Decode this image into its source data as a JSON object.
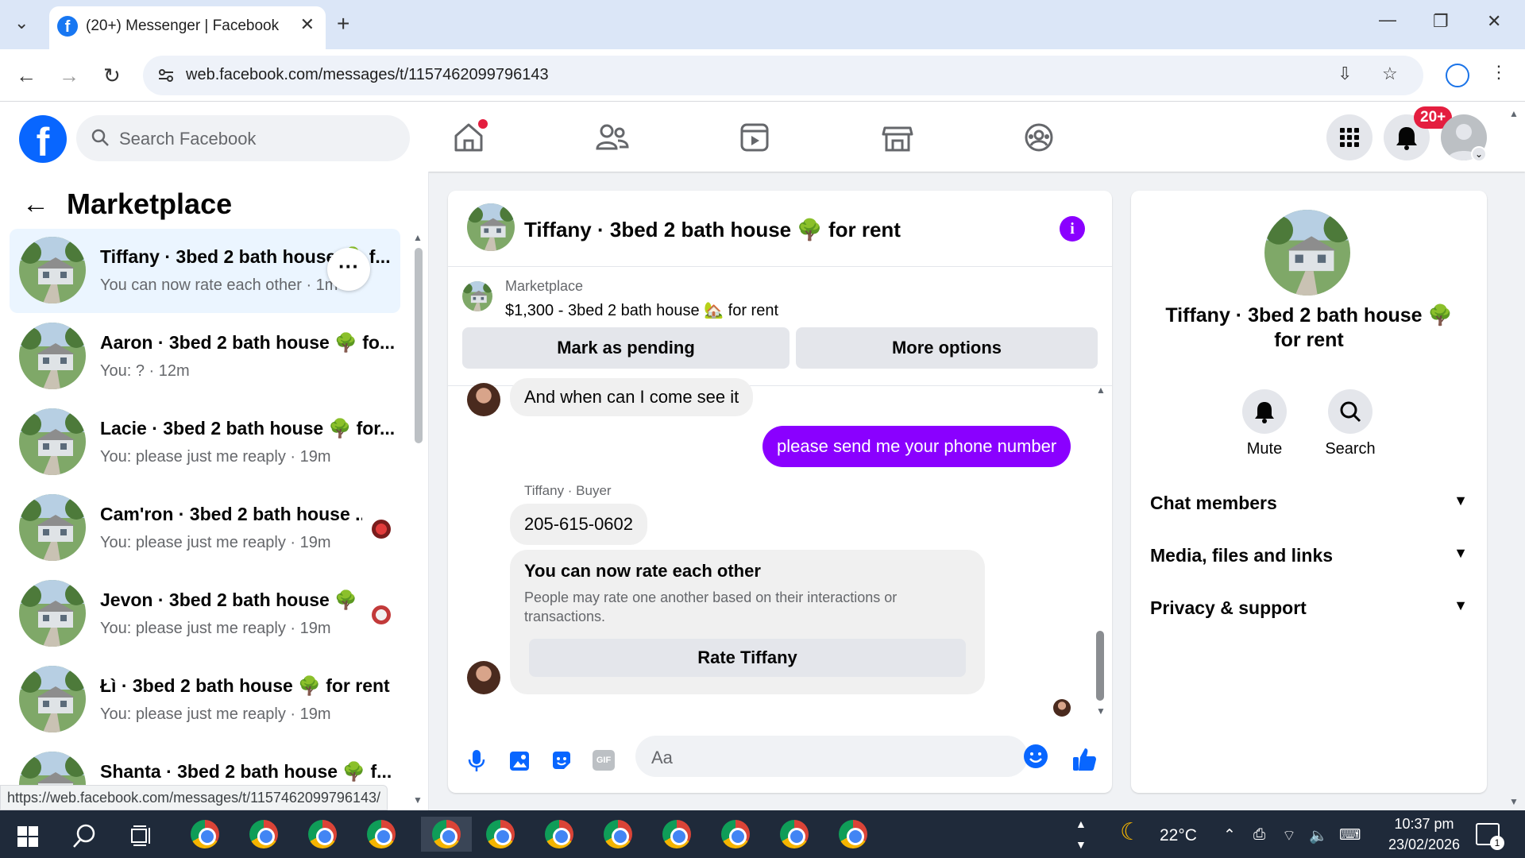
{
  "browser": {
    "tab_title": "(20+) Messenger | Facebook",
    "url": "web.facebook.com/messages/t/1157462099796143",
    "status_url": "https://web.facebook.com/messages/t/1157462099796143/"
  },
  "fb": {
    "search_placeholder": "Search Facebook",
    "notif_badge": "20+"
  },
  "left": {
    "title": "Marketplace",
    "conversations": [
      {
        "name": "Tiffany · 3bed 2 bath house 🌳 f...",
        "sub": "You can now rate each other · 1m"
      },
      {
        "name": "Aaron · 3bed 2 bath house 🌳 fo...",
        "sub": "You: ? · 12m"
      },
      {
        "name": "Lacie · 3bed 2 bath house 🌳 for...",
        "sub": "You: please just me reaply · 19m"
      },
      {
        "name": "Cam'ron · 3bed 2 bath house ...",
        "sub": "You: please just me reaply · 19m"
      },
      {
        "name": "Jevon · 3bed 2 bath house 🌳 ...",
        "sub": "You: please just me reaply · 19m"
      },
      {
        "name": "Łì · 3bed 2 bath house 🌳 for rent",
        "sub": "You: please just me reaply · 19m"
      },
      {
        "name": "Shanta · 3bed 2 bath house 🌳 f...",
        "sub": ""
      }
    ]
  },
  "chat": {
    "title": "Tiffany · 3bed 2 bath house 🌳 for rent",
    "marketplace_label": "Marketplace",
    "listing": "$1,300 - 3bed 2 bath house 🏡 for rent",
    "mark_pending": "Mark as pending",
    "more_options": "More options",
    "msg_in_1": "And when can I come see it",
    "msg_out_1": "please send me your  phone number",
    "sender_label": "Tiffany · Buyer",
    "msg_in_2": "205-615-0602",
    "rate_title": "You can now rate each other",
    "rate_desc": "People may rate one another based on their interactions or transactions.",
    "rate_button": "Rate Tiffany",
    "input_placeholder": "Aa"
  },
  "right": {
    "title": "Tiffany · 3bed 2 bath house 🌳 for rent",
    "mute": "Mute",
    "search": "Search",
    "rows": [
      "Chat members",
      "Media, files and links",
      "Privacy & support"
    ]
  },
  "taskbar": {
    "weather": "22°C",
    "time": "10:37 pm",
    "date": "23/02/2026",
    "notif_count": "1"
  },
  "colors": {
    "fb_blue": "#0866ff",
    "accent_purple": "#8a00ff",
    "badge_red": "#e41e3f"
  }
}
